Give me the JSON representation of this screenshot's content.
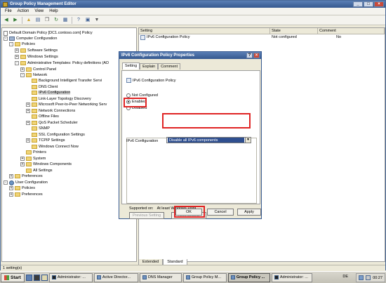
{
  "window": {
    "title": "Group Policy Management Editor"
  },
  "menu": [
    "File",
    "Action",
    "View",
    "Help"
  ],
  "toolbar": [
    "back-icon",
    "forward-icon",
    "up-icon",
    "show-tree-icon",
    "copy-icon",
    "refresh-icon",
    "export-icon",
    "help-icon",
    "properties-icon",
    "filter-icon"
  ],
  "tree": [
    {
      "label": "Default Domain Policy [DC1.contoso.com] Policy",
      "icon": "doc",
      "exp": "",
      "depth": 0
    },
    {
      "label": "Computer Configuration",
      "icon": "computer",
      "exp": "-",
      "depth": 0
    },
    {
      "label": "Policies",
      "icon": "folder",
      "exp": "-",
      "depth": 1
    },
    {
      "label": "Software Settings",
      "icon": "folder",
      "exp": "+",
      "depth": 2
    },
    {
      "label": "Windows Settings",
      "icon": "folder",
      "exp": "+",
      "depth": 2
    },
    {
      "label": "Administrative Templates: Policy definitions (AD",
      "icon": "folder",
      "exp": "-",
      "depth": 2
    },
    {
      "label": "Control Panel",
      "icon": "folder",
      "exp": "+",
      "depth": 3
    },
    {
      "label": "Network",
      "icon": "folder",
      "exp": "-",
      "depth": 3
    },
    {
      "label": "Background Intelligent Transfer Servi",
      "icon": "folder",
      "exp": "",
      "depth": 4
    },
    {
      "label": "DNS Client",
      "icon": "folder",
      "exp": "",
      "depth": 4
    },
    {
      "label": "IPv6 Configuration",
      "icon": "folder",
      "exp": "",
      "depth": 4,
      "selected": true
    },
    {
      "label": "Link-Layer Topology Discovery",
      "icon": "folder",
      "exp": "",
      "depth": 4
    },
    {
      "label": "Microsoft Peer-to-Peer Networking Serv",
      "icon": "folder",
      "exp": "+",
      "depth": 4
    },
    {
      "label": "Network Connections",
      "icon": "folder",
      "exp": "+",
      "depth": 4
    },
    {
      "label": "Offline Files",
      "icon": "folder",
      "exp": "",
      "depth": 4
    },
    {
      "label": "QoS Packet Scheduler",
      "icon": "folder",
      "exp": "+",
      "depth": 4
    },
    {
      "label": "SNMP",
      "icon": "folder",
      "exp": "",
      "depth": 4
    },
    {
      "label": "SSL Configuration Settings",
      "icon": "folder",
      "exp": "",
      "depth": 4
    },
    {
      "label": "TCPIP Settings",
      "icon": "folder",
      "exp": "+",
      "depth": 4
    },
    {
      "label": "Windows Connect Now",
      "icon": "folder",
      "exp": "",
      "depth": 4
    },
    {
      "label": "Printers",
      "icon": "folder",
      "exp": "",
      "depth": 3
    },
    {
      "label": "System",
      "icon": "folder",
      "exp": "+",
      "depth": 3
    },
    {
      "label": "Windows Components",
      "icon": "folder",
      "exp": "+",
      "depth": 3
    },
    {
      "label": "All Settings",
      "icon": "folder",
      "exp": "",
      "depth": 3
    },
    {
      "label": "Preferences",
      "icon": "folder",
      "exp": "+",
      "depth": 1
    },
    {
      "label": "User Configuration",
      "icon": "user",
      "exp": "-",
      "depth": 0
    },
    {
      "label": "Policies",
      "icon": "folder",
      "exp": "+",
      "depth": 1
    },
    {
      "label": "Preferences",
      "icon": "folder",
      "exp": "+",
      "depth": 1
    }
  ],
  "list": {
    "headers": [
      "Setting",
      "State",
      "Comment"
    ],
    "rows": [
      {
        "setting": "IPv6 Configuration Policy",
        "state": "Not configured",
        "comment": "No"
      }
    ]
  },
  "bottom_tabs": [
    "Extended",
    "Standard"
  ],
  "status": "1 setting(s)",
  "dialog": {
    "title": "IPv6 Configuration Policy Properties",
    "tabs": [
      "Setting",
      "Explain",
      "Comment"
    ],
    "policy_name": "IPv6 Configuration Policy",
    "options": [
      "Not Configured",
      "Enabled",
      "Disabled"
    ],
    "selected_option": "Enabled",
    "config_label": "IPv6 Configuration",
    "config_value": "Disable all IPv6 components",
    "supported_label": "Supported on:",
    "supported_value": "At least Windows Vista",
    "prev_button": "Previous Setting",
    "next_button": "Next Setting",
    "ok_button": "OK",
    "cancel_button": "Cancel",
    "apply_button": "Apply"
  },
  "taskbar": {
    "start_label": "Start",
    "items": [
      {
        "label": "Administrator: ..."
      },
      {
        "label": "Active Director..."
      },
      {
        "label": "DNS Manager"
      },
      {
        "label": "Group Policy M..."
      },
      {
        "label": "Group Policy ...",
        "active": true
      },
      {
        "label": "Administrator: ..."
      }
    ],
    "lang": "DE",
    "clock": "00:27"
  },
  "highlight_color": "#e02424"
}
